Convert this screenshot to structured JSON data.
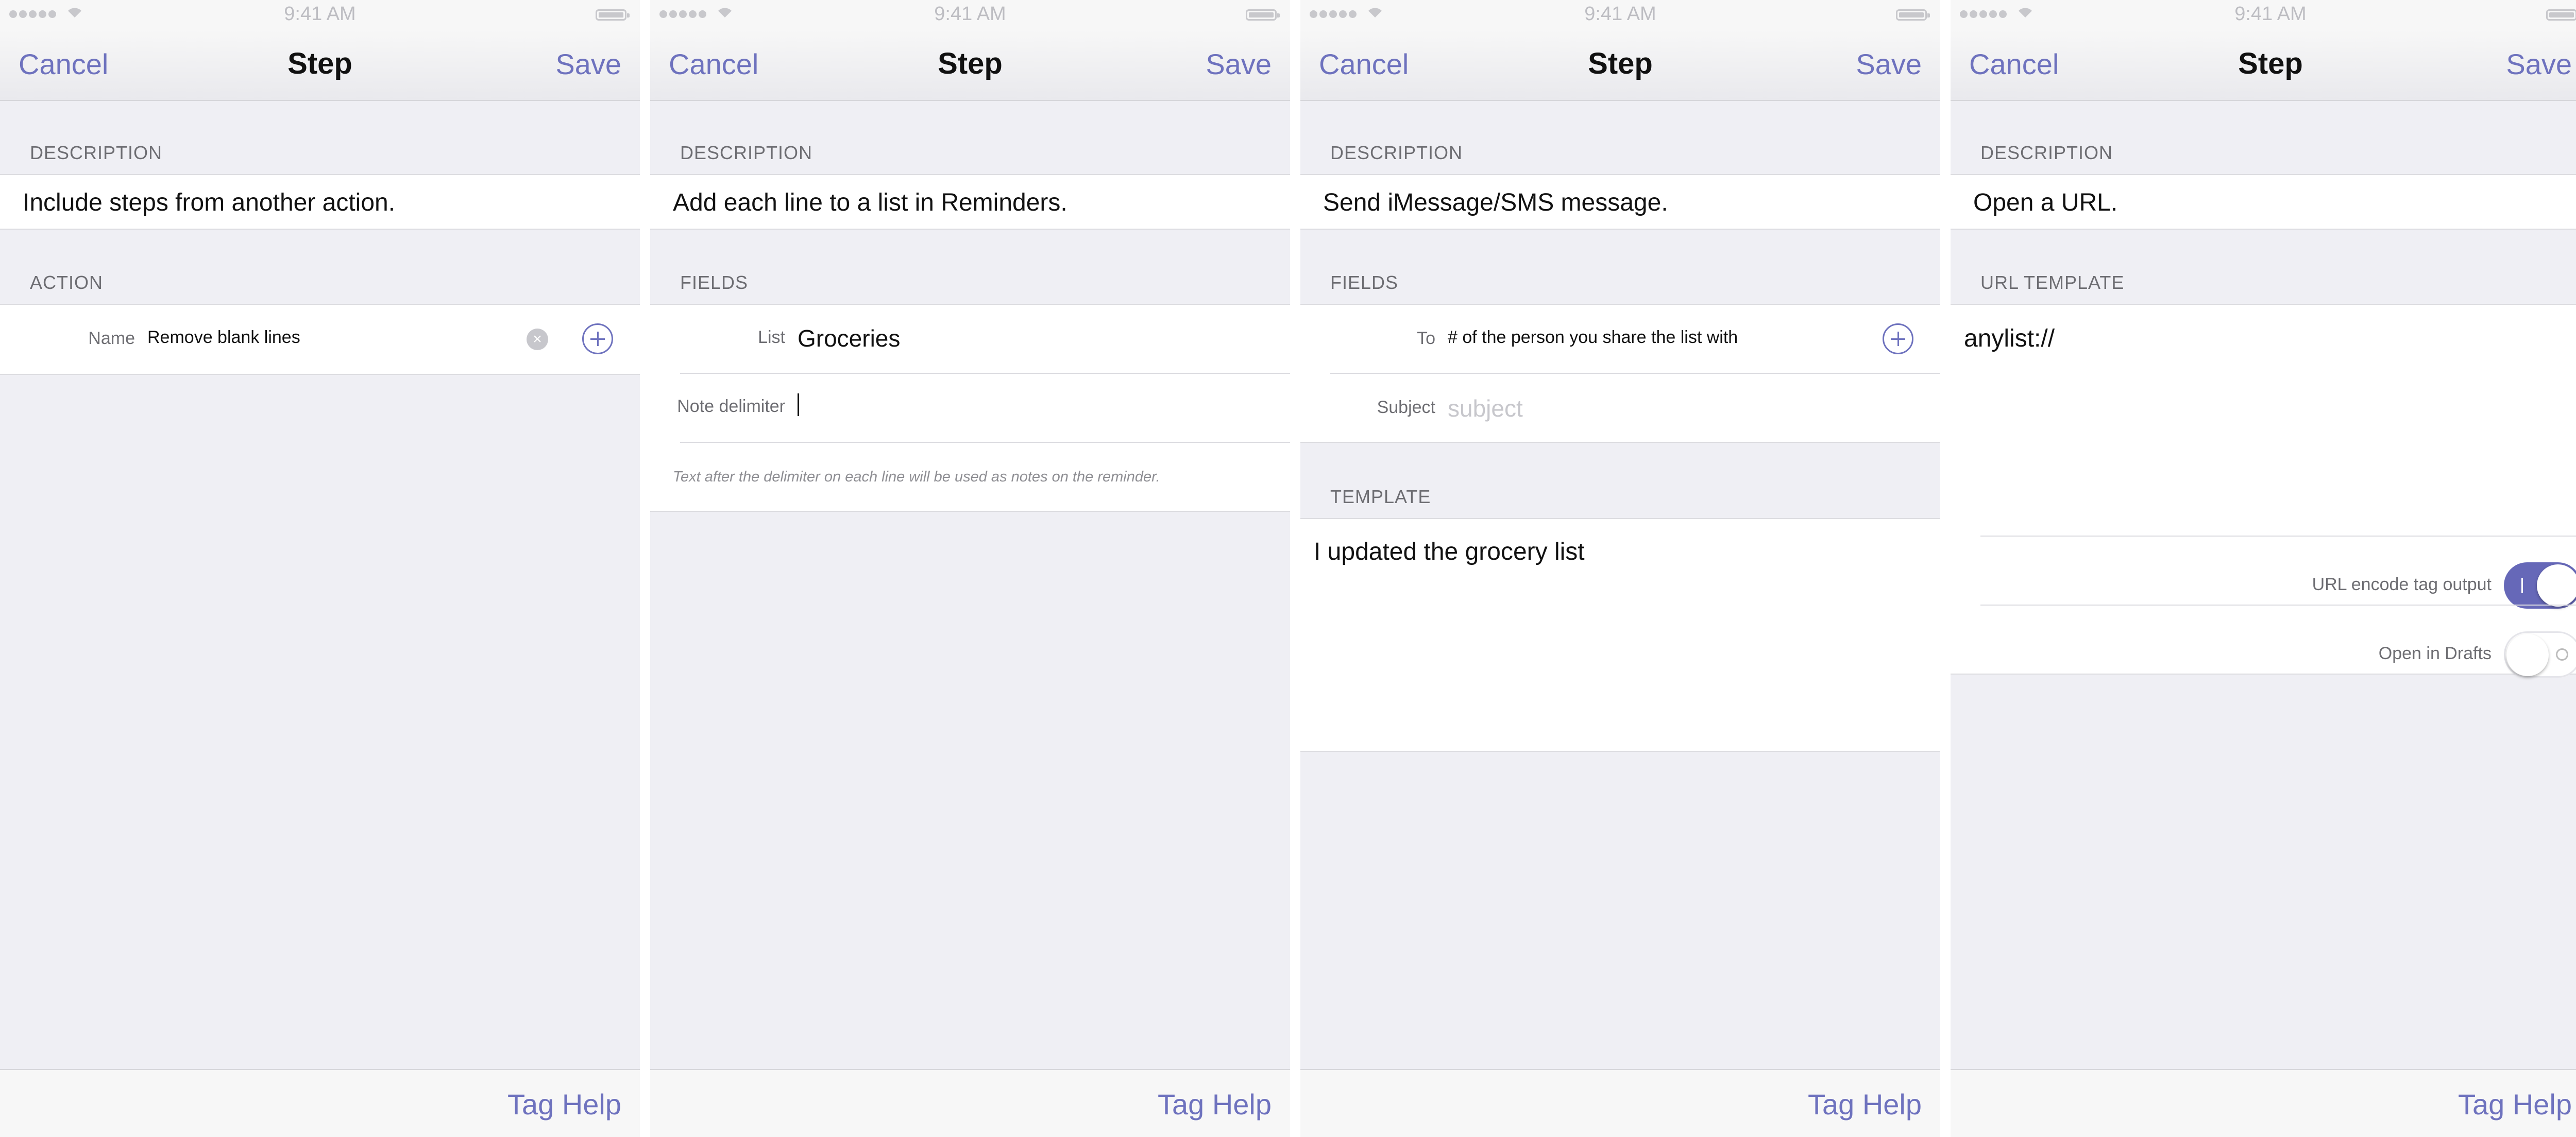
{
  "status": {
    "time": "9:41 AM"
  },
  "nav": {
    "cancel": "Cancel",
    "title": "Step",
    "save": "Save"
  },
  "toolbar": {
    "tag_help": "Tag Help"
  },
  "screens": [
    {
      "description_header": "DESCRIPTION",
      "description": "Include steps from another action.",
      "section_header": "ACTION",
      "field_label": "Name",
      "field_value": "Remove blank lines"
    },
    {
      "description_header": "DESCRIPTION",
      "description": "Add each line to a list in Reminders.",
      "section_header": "FIELDS",
      "list_label": "List",
      "list_value": "Groceries",
      "delimiter_label": "Note delimiter",
      "delimiter_value": "",
      "footnote": "Text after the delimiter on each line will be used as notes on the reminder."
    },
    {
      "description_header": "DESCRIPTION",
      "description": "Send iMessage/SMS message.",
      "section_header": "FIELDS",
      "to_label": "To",
      "to_value": "# of the person you share the list with",
      "subject_label": "Subject",
      "subject_placeholder": "subject",
      "template_header": "TEMPLATE",
      "template_value": "I updated the grocery list"
    },
    {
      "description_header": "DESCRIPTION",
      "description": "Open a URL.",
      "section_header": "URL TEMPLATE",
      "url_value": "anylist://",
      "toggle1_label": "URL encode tag output",
      "toggle1_on": true,
      "toggle2_label": "Open in Drafts",
      "toggle2_on": false
    }
  ],
  "colors": {
    "accent": "#6e72be",
    "toggle_on": "#6668b8",
    "background": "#efeff4"
  }
}
